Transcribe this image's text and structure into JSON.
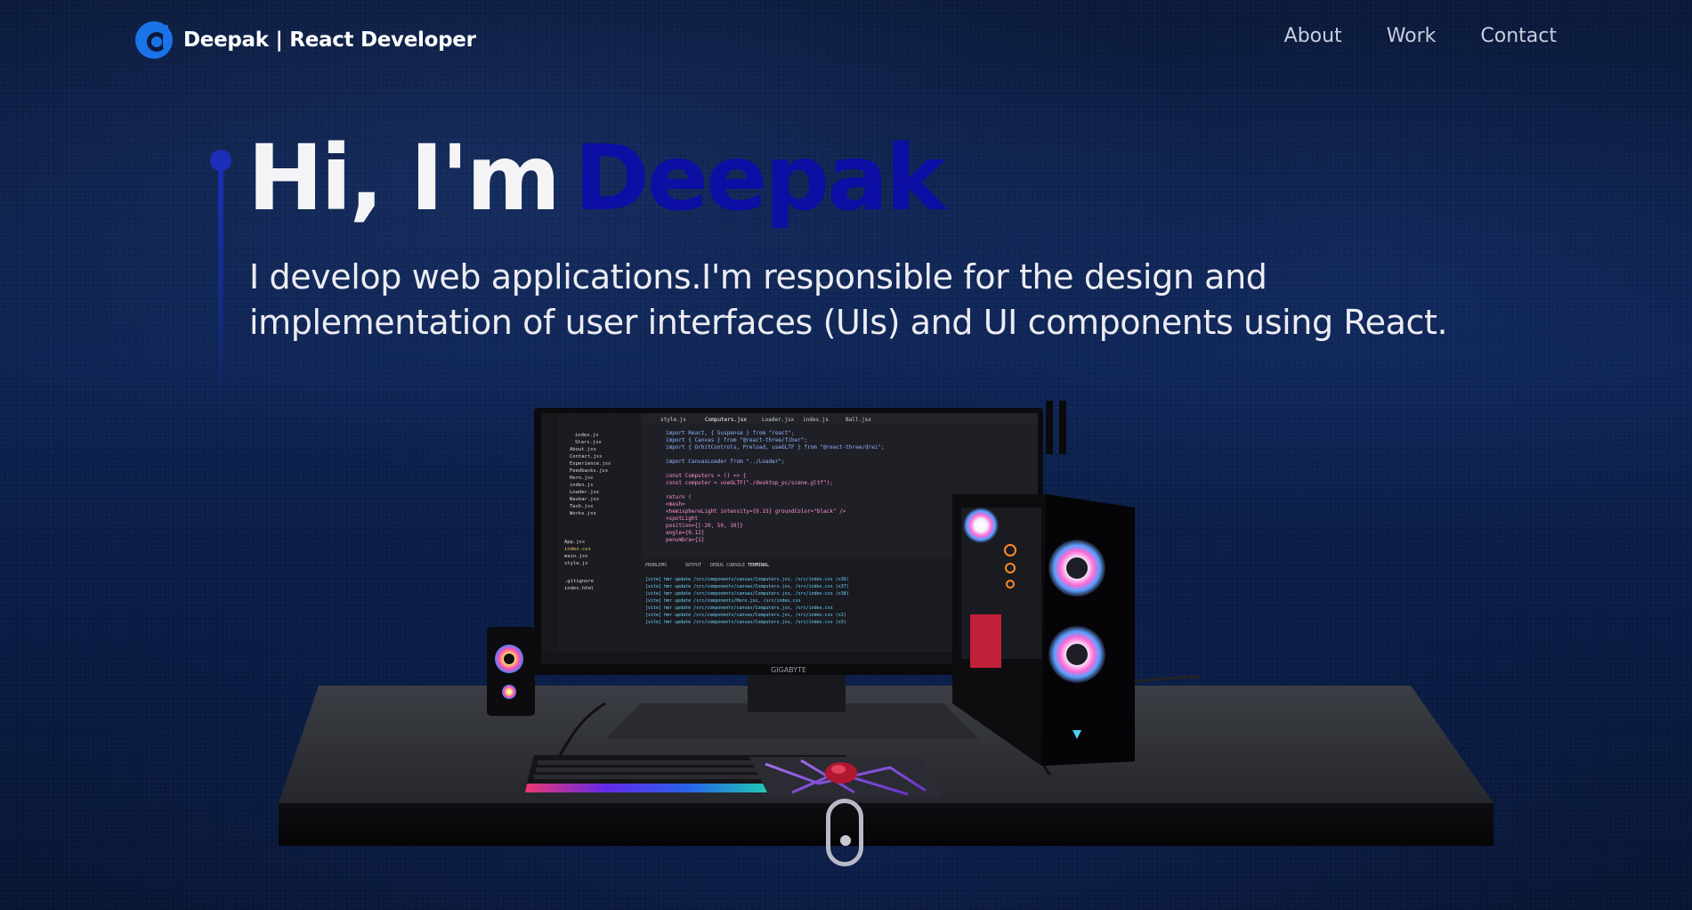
{
  "nav": {
    "brand": "Deepak | React Developer",
    "links": [
      {
        "label": "About"
      },
      {
        "label": "Work"
      },
      {
        "label": "Contact"
      }
    ]
  },
  "hero": {
    "greeting": "Hi, I'm",
    "name": "Deepak",
    "subtitle_line1": "I develop web applications.I'm responsible for the design and",
    "subtitle_line2": "implementation of user interfaces (UIs) and UI components using React."
  },
  "scene": {
    "monitor_brand": "GIGABYTE",
    "editor_tabs": [
      "style.js",
      "Computers.jsx",
      "Loader.jsx",
      "index.js",
      "Ball.jsx"
    ],
    "explorer_files": [
      "index.js",
      "Stars.jsx",
      "About.jsx",
      "Contact.jsx",
      "Experience.jsx",
      "Feedbacks.jsx",
      "Hero.jsx",
      "index.js",
      "Loader.jsx",
      "Navbar.jsx",
      "Tech.jsx",
      "Works.jsx",
      "App.jsx",
      "index.css",
      "main.jsx",
      "style.js",
      ".gitignore",
      "index.html"
    ],
    "code_lines": [
      "import React, { Suspense } from \"react\";",
      "import { Canvas } from \"@react-three/fiber\";",
      "import { OrbitControls, Preload, useGLTF } from \"@react-three/drei\";",
      "",
      "import CanvasLoader from \"../Loader\";",
      "",
      "const Computers = () => {",
      "  const computer = useGLTF(\"./desktop_pc/scene.gltf\");",
      "",
      "  return (",
      "    <mesh>",
      "      <hemisphereLight intensity={0.15} groundColor=\"black\" />",
      "      <spotLight",
      "        position={[-20, 50, 10]}",
      "        angle={0.12}",
      "        penumbra={1}"
    ],
    "terminal_lines": [
      "[vite] hmr update /src/components/canvas/Computers.jsx, /src/index.css (x36)",
      "[vite] hmr update /src/components/canvas/Computers.jsx, /src/index.css (x37)",
      "[vite] hmr update /src/components/canvas/Computers.jsx, /src/index.css (x38)",
      "[vite] hmr update /src/components/Hero.jsx, /src/index.css",
      "[vite] hmr update /src/components/canvas/Computers.jsx, /src/index.css",
      "[vite] hmr update /src/components/canvas/Computers.jsx, /src/index.css (x2)",
      "[vite] hmr update /src/components/canvas/Computers.jsx, /src/index.css (x3)"
    ],
    "terminal_tabs": [
      "PROBLEMS",
      "OUTPUT",
      "DEBUG CONSOLE",
      "TERMINAL"
    ]
  },
  "colors": {
    "accent": "#0c0ea4",
    "rail": "#1b2fb8",
    "logo": "#1a73e8"
  }
}
